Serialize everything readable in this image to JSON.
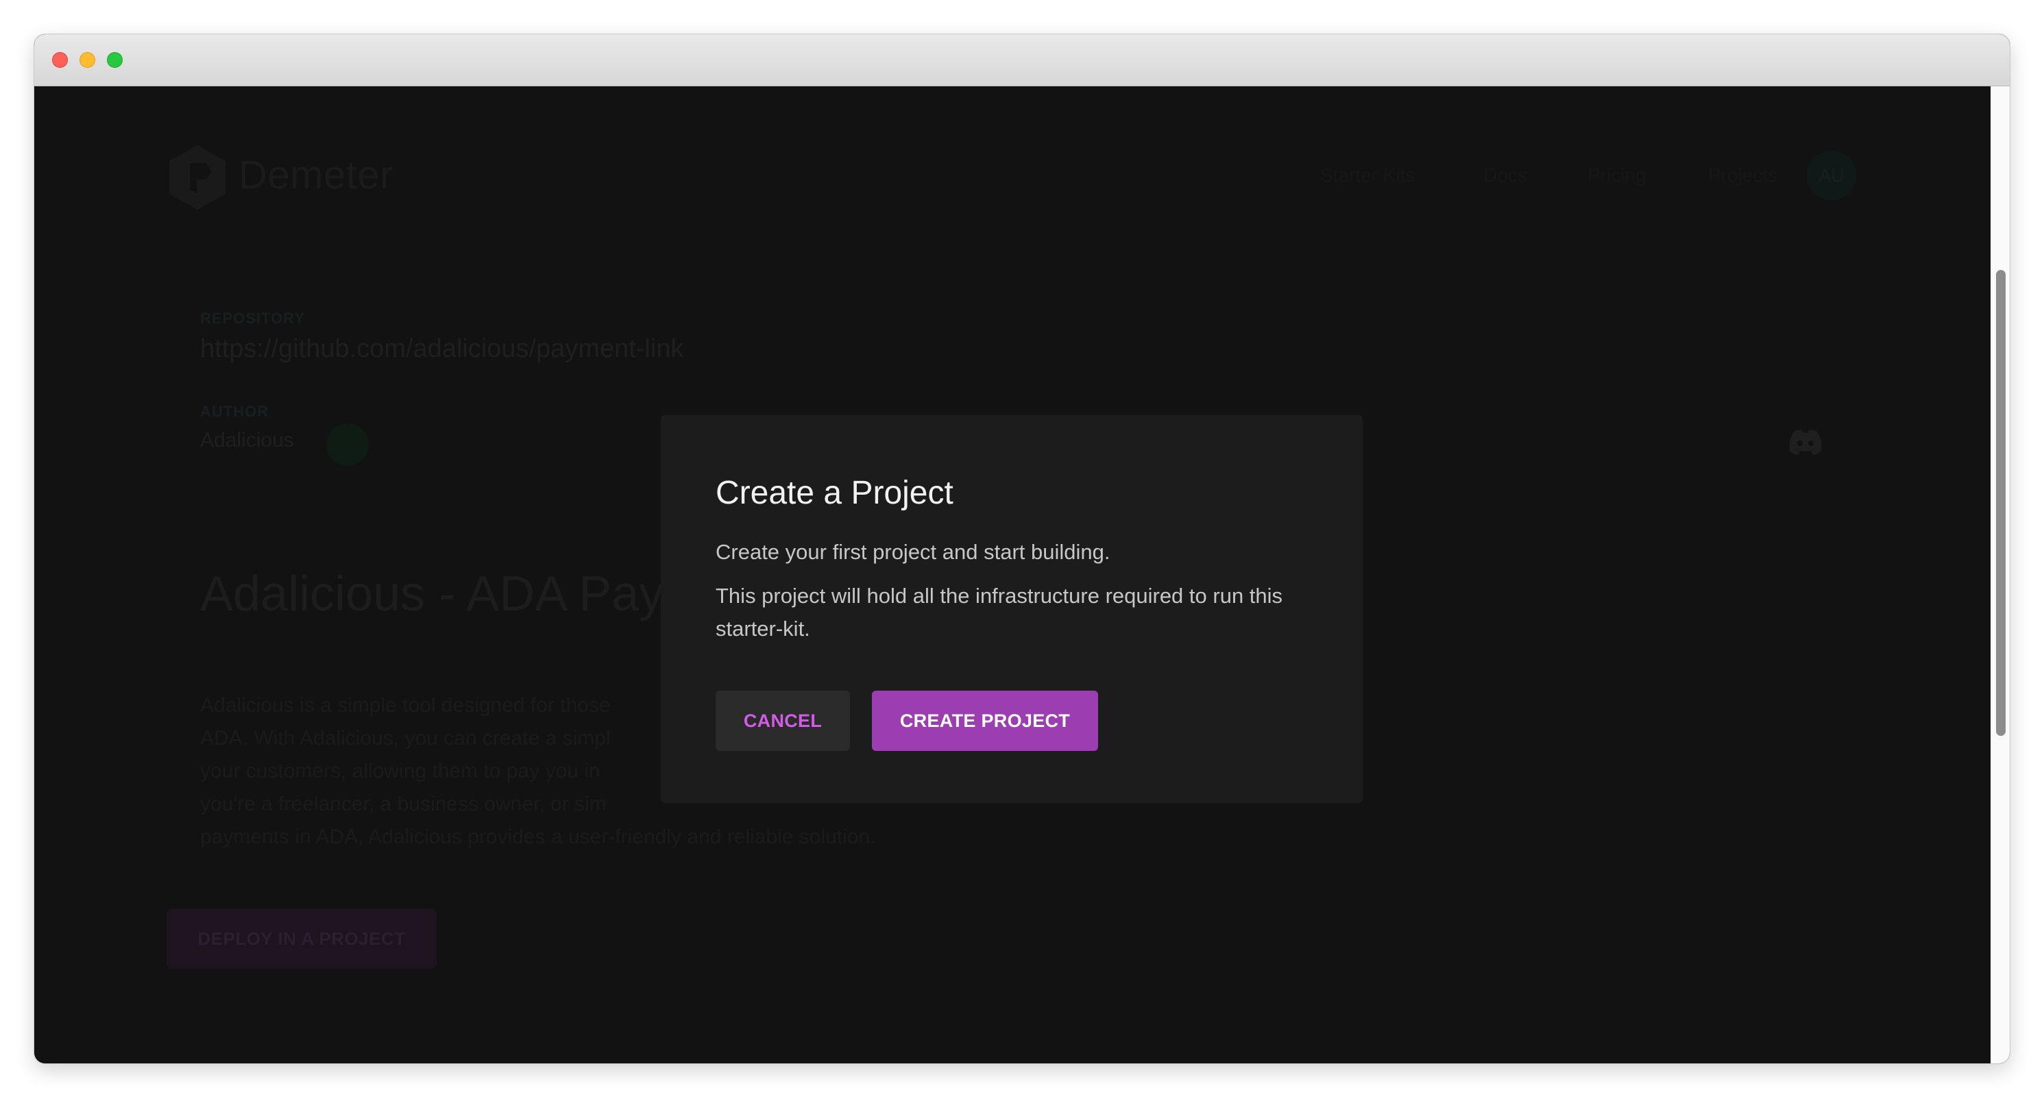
{
  "nav": {
    "brand": "Demeter",
    "links": [
      "Starter Kits",
      "Docs",
      "Pricing",
      "Projects"
    ],
    "avatar_initials": "AU"
  },
  "kit": {
    "repository_label": "REPOSITORY",
    "repository_url": "https://github.com/adalicious/payment-link",
    "author_label": "AUTHOR",
    "author_name": "Adalicious",
    "title": "Adalicious - ADA Pay",
    "description_lines": [
      "Adalicious is a simple tool designed for those",
      "ADA. With Adalicious, you can create a simpl",
      "your customers, allowing them to pay you in",
      "you're a freelancer, a business owner, or sim",
      "payments in ADA, Adalicious provides a user-friendly and reliable solution."
    ],
    "deploy_label": "DEPLOY IN A PROJECT"
  },
  "modal": {
    "title": "Create a Project",
    "paragraph_1": "Create your first project and start building.",
    "paragraph_2": "This project will hold all the infrastructure required to run this starter-kit.",
    "cancel_label": "CANCEL",
    "create_label": "CREATE PROJECT"
  },
  "colors": {
    "accent": "#9c3eb1",
    "cancel_text": "#d35ce6",
    "modal_bg": "#1c1c1d",
    "page_bg": "#121212"
  }
}
